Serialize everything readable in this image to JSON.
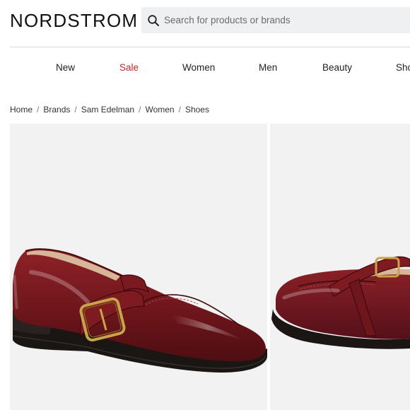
{
  "header": {
    "logo": "NORDSTROM",
    "search_placeholder": "Search for products or brands"
  },
  "nav": {
    "items": [
      {
        "label": "New",
        "color": "#222222"
      },
      {
        "label": "Sale",
        "color": "#c1272d"
      },
      {
        "label": "Women",
        "color": "#222222"
      },
      {
        "label": "Men",
        "color": "#222222"
      },
      {
        "label": "Beauty",
        "color": "#222222"
      },
      {
        "label": "Sho",
        "color": "#222222"
      }
    ]
  },
  "breadcrumb": {
    "items": [
      "Home",
      "Brands",
      "Sam Edelman",
      "Women",
      "Shoes"
    ],
    "separator": "/"
  },
  "gallery": {
    "product_color": "#7a1a1f",
    "images": [
      "burgundy-loafer-side-view",
      "burgundy-loafer-angle-view"
    ]
  }
}
